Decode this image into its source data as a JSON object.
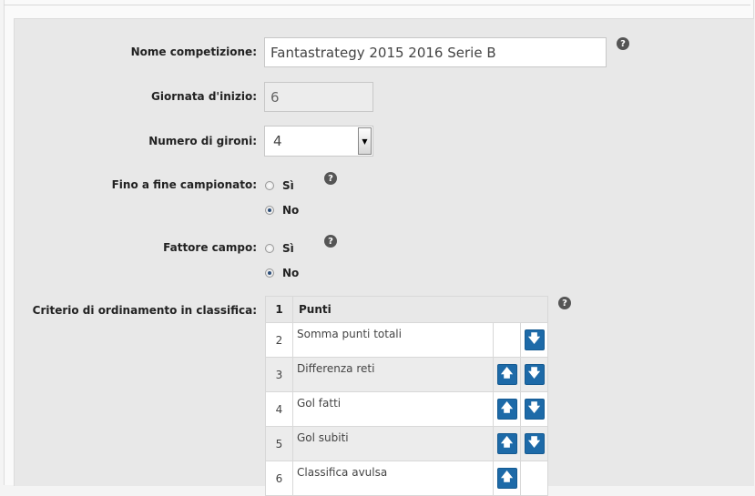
{
  "form": {
    "nome_label": "Nome competizione:",
    "nome_value": "Fantastrategy 2015 2016 Serie B",
    "giornata_label": "Giornata d'inizio:",
    "giornata_value": "6",
    "gironi_label": "Numero di gironi:",
    "gironi_value": "4",
    "fino_label": "Fino a fine campionato:",
    "fino_options": [
      "Sì",
      "No"
    ],
    "fino_selected": "No",
    "fattore_label": "Fattore campo:",
    "fattore_options": [
      "Sì",
      "No"
    ],
    "fattore_selected": "No",
    "criterio_label": "Criterio di ordinamento in classifica:",
    "help_glyph": "?"
  },
  "criteria": {
    "header": {
      "num": "1",
      "name": "Punti"
    },
    "rows": [
      {
        "num": "2",
        "name": "Somma punti totali",
        "up": false,
        "down": true
      },
      {
        "num": "3",
        "name": "Differenza reti",
        "up": true,
        "down": true
      },
      {
        "num": "4",
        "name": "Gol fatti",
        "up": true,
        "down": true
      },
      {
        "num": "5",
        "name": "Gol subiti",
        "up": true,
        "down": true
      },
      {
        "num": "6",
        "name": "Classifica avulsa",
        "up": true,
        "down": false
      }
    ],
    "up_icon": "arrow-up-icon",
    "down_icon": "arrow-down-icon"
  }
}
